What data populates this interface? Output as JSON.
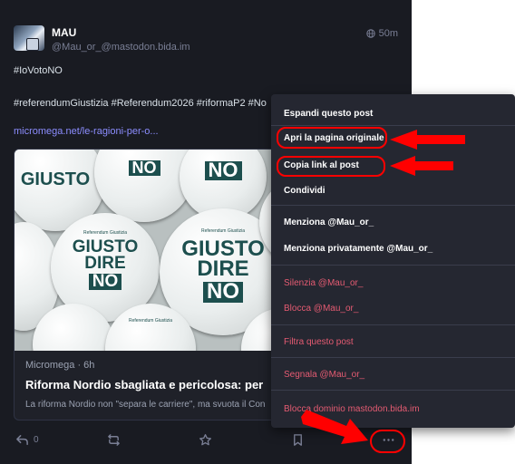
{
  "author": {
    "display_name": "MAU",
    "handle": "@Mau_or_@mastodon.bida.im",
    "time": "50m"
  },
  "post": {
    "line1": "#IoVotoNO",
    "line2": "#referendumGiustizia #Referendum2026 #riformaP2 #No",
    "link": "micromega.net/le-ragioni-per-o..."
  },
  "card": {
    "source": "Micromega · 6h",
    "title": "Riforma Nordio sbagliata e pericolosa: per",
    "description": "La riforma Nordio non \"separa le carriere\", ma svuota il Con",
    "badge_small_text": "Referendum Giustizia",
    "badge_line1": "GIUSTO",
    "badge_line2": "DIRE",
    "badge_no": "NO"
  },
  "actions": {
    "reply_count": "0"
  },
  "menu": {
    "expand": "Espandi questo post",
    "open_original": "Apri la pagina originale",
    "copy_link": "Copia link al post",
    "share": "Condividi",
    "mention": "Menziona @Mau_or_",
    "mention_private": "Menziona privatamente @Mau_or_",
    "mute": "Silenzia @Mau_or_",
    "block": "Blocca @Mau_or_",
    "filter": "Filtra questo post",
    "report": "Segnala @Mau_or_",
    "block_domain": "Blocca dominio mastodon.bida.im"
  },
  "colors": {
    "background": "#191b22",
    "menu_background": "#252731",
    "danger": "#e55b72",
    "link": "#8c8dff",
    "annotation": "#ff0000"
  },
  "icons": [
    "globe-icon",
    "reply-icon",
    "boost-icon",
    "star-icon",
    "bookmark-icon",
    "more-icon"
  ]
}
